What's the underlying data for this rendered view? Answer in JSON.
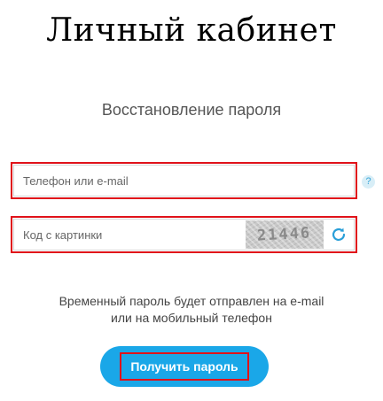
{
  "header": {
    "title": "Личный кабинет"
  },
  "form": {
    "subtitle": "Восстановление пароля",
    "login_placeholder": "Телефон или e-mail",
    "help_icon_glyph": "?",
    "captcha_placeholder": "Код с картинки",
    "captcha_text": "21446",
    "refresh_icon": "refresh-icon",
    "note_line1": "Временный пароль будет отправлен на e-mail",
    "note_line2": "или на мобильный телефон",
    "submit_label": "Получить пароль"
  },
  "colors": {
    "accent": "#1aa7e8",
    "highlight": "#e0121a"
  }
}
